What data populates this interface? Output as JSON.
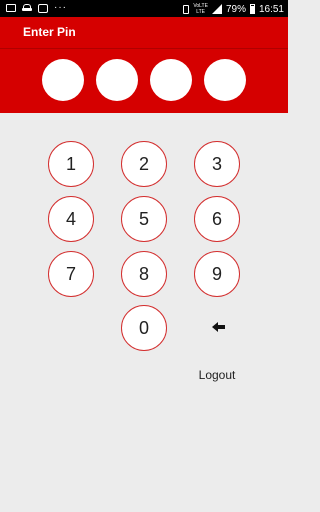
{
  "status_bar": {
    "notification_more": "···",
    "network_label": "VoLTE",
    "network_sub": "LTE",
    "battery_percent": "79%",
    "time": "16:51",
    "icons": [
      "image-icon",
      "car-icon",
      "message-icon",
      "vibrate-icon",
      "signal-icon",
      "battery-icon"
    ]
  },
  "header": {
    "title": "Enter Pin"
  },
  "pin": {
    "length": 4,
    "entered": 0
  },
  "keypad": {
    "keys": [
      "1",
      "2",
      "3",
      "4",
      "5",
      "6",
      "7",
      "8",
      "9",
      "0"
    ],
    "backspace_icon": "backspace-arrow-icon"
  },
  "logout_label": "Logout",
  "colors": {
    "accent": "#d50000",
    "key_border": "#d32f2f",
    "background": "#ececec"
  }
}
